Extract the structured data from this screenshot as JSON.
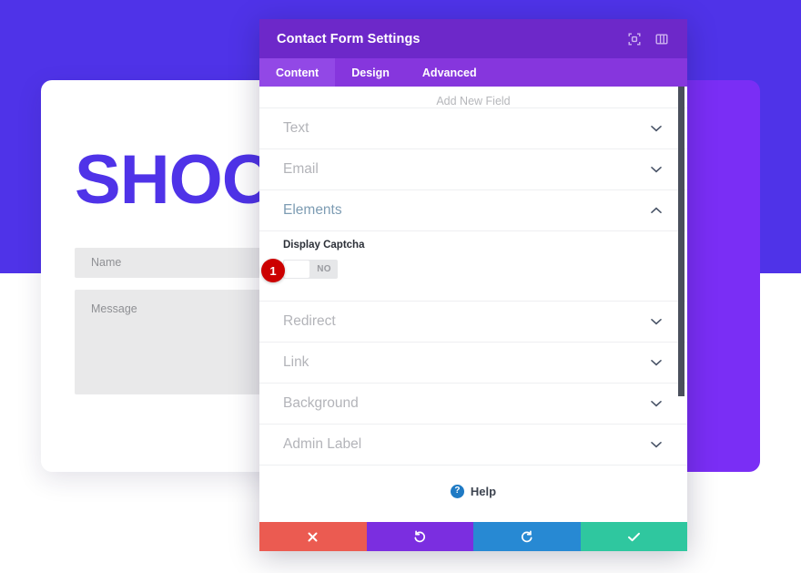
{
  "background_page": {
    "heading": "SHOOT",
    "name_placeholder": "Name",
    "message_placeholder": "Message",
    "band_color": "#4f33e8",
    "card_color": "#7a2ef5",
    "heading_color": "#4f33e8"
  },
  "modal": {
    "title": "Contact Form Settings",
    "header_color": "#6d28c9",
    "icons": {
      "expand": "expand-view-icon",
      "layout": "panel-layout-icon"
    },
    "tabs": [
      {
        "label": "Content",
        "active": true
      },
      {
        "label": "Design",
        "active": false
      },
      {
        "label": "Advanced",
        "active": false
      }
    ],
    "add_new_field": "Add New Field",
    "sections": [
      {
        "label": "Text",
        "open": false,
        "chevron": "chevron-down-icon"
      },
      {
        "label": "Email",
        "open": false,
        "chevron": "chevron-down-icon"
      },
      {
        "label": "Elements",
        "open": true,
        "chevron": "chevron-up-icon"
      }
    ],
    "sections_after": [
      {
        "label": "Redirect",
        "open": false,
        "chevron": "chevron-down-icon"
      },
      {
        "label": "Link",
        "open": false,
        "chevron": "chevron-down-icon"
      },
      {
        "label": "Background",
        "open": false,
        "chevron": "chevron-down-icon"
      },
      {
        "label": "Admin Label",
        "open": false,
        "chevron": "chevron-down-icon"
      }
    ],
    "elements_panel": {
      "field_label": "Display Captcha",
      "toggle_value": "NO",
      "annotation_badge": "1",
      "badge_color": "#cc0000"
    },
    "help": {
      "label": "Help",
      "icon": "question-mark-icon"
    },
    "footer_buttons": [
      {
        "name": "cancel-button",
        "icon": "close-x-icon",
        "color": "#eb5b51"
      },
      {
        "name": "undo-button",
        "icon": "undo-icon",
        "color": "#7b2ee0"
      },
      {
        "name": "redo-button",
        "icon": "redo-icon",
        "color": "#2789d3"
      },
      {
        "name": "save-button",
        "icon": "checkmark-icon",
        "color": "#2fc79f"
      }
    ]
  }
}
